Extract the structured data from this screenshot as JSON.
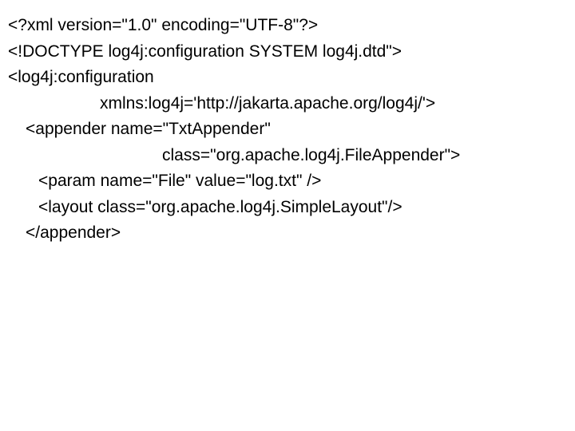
{
  "code": {
    "lines": [
      "<?xml version=\"1.0\" encoding=\"UTF-8\"?>",
      "<!DOCTYPE log4j:configuration SYSTEM log4j.dtd\">",
      "<log4j:configuration",
      "xmlns:log4j='http://jakarta.apache.org/log4j/'>",
      "<appender name=\"TxtAppender\"",
      "class=\"org.apache.log4j.FileAppender\">",
      "<param name=\"File\" value=\"log.txt\" />",
      "<layout class=\"org.apache.log4j.SimpleLayout\"/>",
      "</appender>"
    ]
  }
}
